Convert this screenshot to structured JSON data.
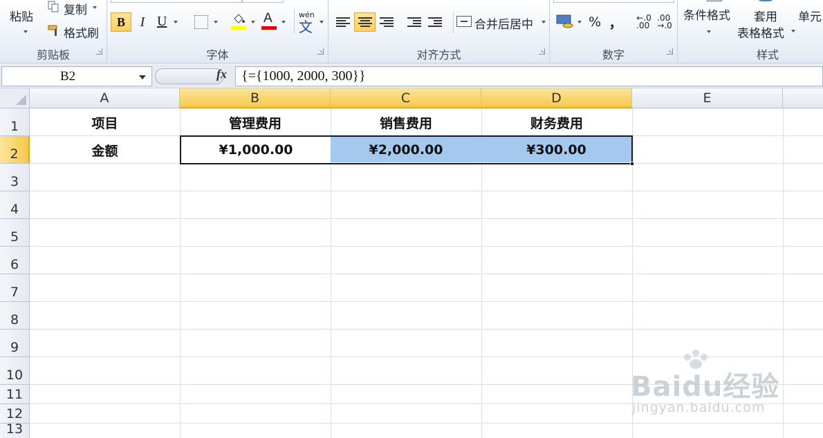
{
  "ribbon": {
    "clipboard": {
      "paste": "粘贴",
      "copy": "复制",
      "format_painter": "格式刷",
      "label": "剪贴板"
    },
    "font": {
      "bold": "B",
      "italic": "I",
      "underline": "U",
      "font_color_glyph": "A",
      "phonetic_glyph": "wén",
      "phonetic_char": "文",
      "label": "字体"
    },
    "alignment": {
      "merge_center": "合并后居中",
      "label": "对齐方式"
    },
    "number": {
      "percent": "%",
      "comma": "，",
      "label": "数字"
    },
    "styles": {
      "conditional_format": "条件格式",
      "apply_line1": "套用",
      "apply_line2": "表格格式",
      "cell": "单元",
      "label": "样式"
    }
  },
  "formula_bar": {
    "name_box": "B2",
    "fx": "fx",
    "formula": "{={1000, 2000, 300}}"
  },
  "sheet": {
    "columns": [
      "A",
      "B",
      "C",
      "D",
      "E"
    ],
    "rows": [
      "1",
      "2",
      "3",
      "4",
      "5",
      "6",
      "7",
      "8",
      "9",
      "10",
      "11",
      "12",
      "13"
    ],
    "cells": {
      "A1": "项目",
      "B1": "管理费用",
      "C1": "销售费用",
      "D1": "财务费用",
      "A2": "金额",
      "B2": "¥1,000.00",
      "C2": "¥2,000.00",
      "D2": "¥300.00"
    }
  },
  "watermark": {
    "brand": "Baidu经验",
    "url": "jingyan.baidu.com"
  },
  "colors": {
    "selection_fill": "#a4c8ee",
    "header_selected": "#f6c94a",
    "active_button": "#ffcf5c"
  }
}
